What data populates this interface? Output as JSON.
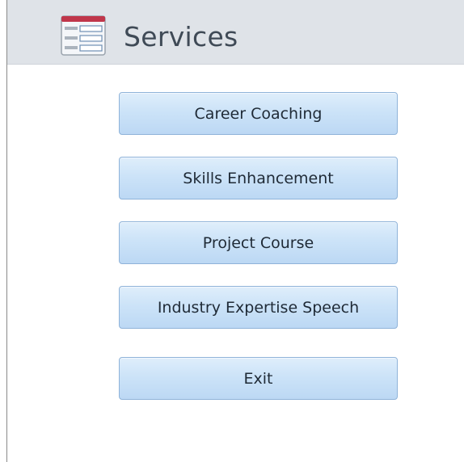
{
  "form": {
    "title": "Services",
    "icon": "form-icon"
  },
  "buttons": [
    {
      "label": "Career Coaching"
    },
    {
      "label": "Skills Enhancement"
    },
    {
      "label": "Project Course"
    },
    {
      "label": "Industry Expertise Speech"
    },
    {
      "label": "Exit"
    }
  ],
  "colors": {
    "header_bg": "#dfe3e8",
    "title_text": "#3f4a56",
    "button_top": "#dfeefb",
    "button_bottom": "#bcd8f4",
    "button_border": "#8fb3d9",
    "icon_accent": "#c0364a"
  }
}
